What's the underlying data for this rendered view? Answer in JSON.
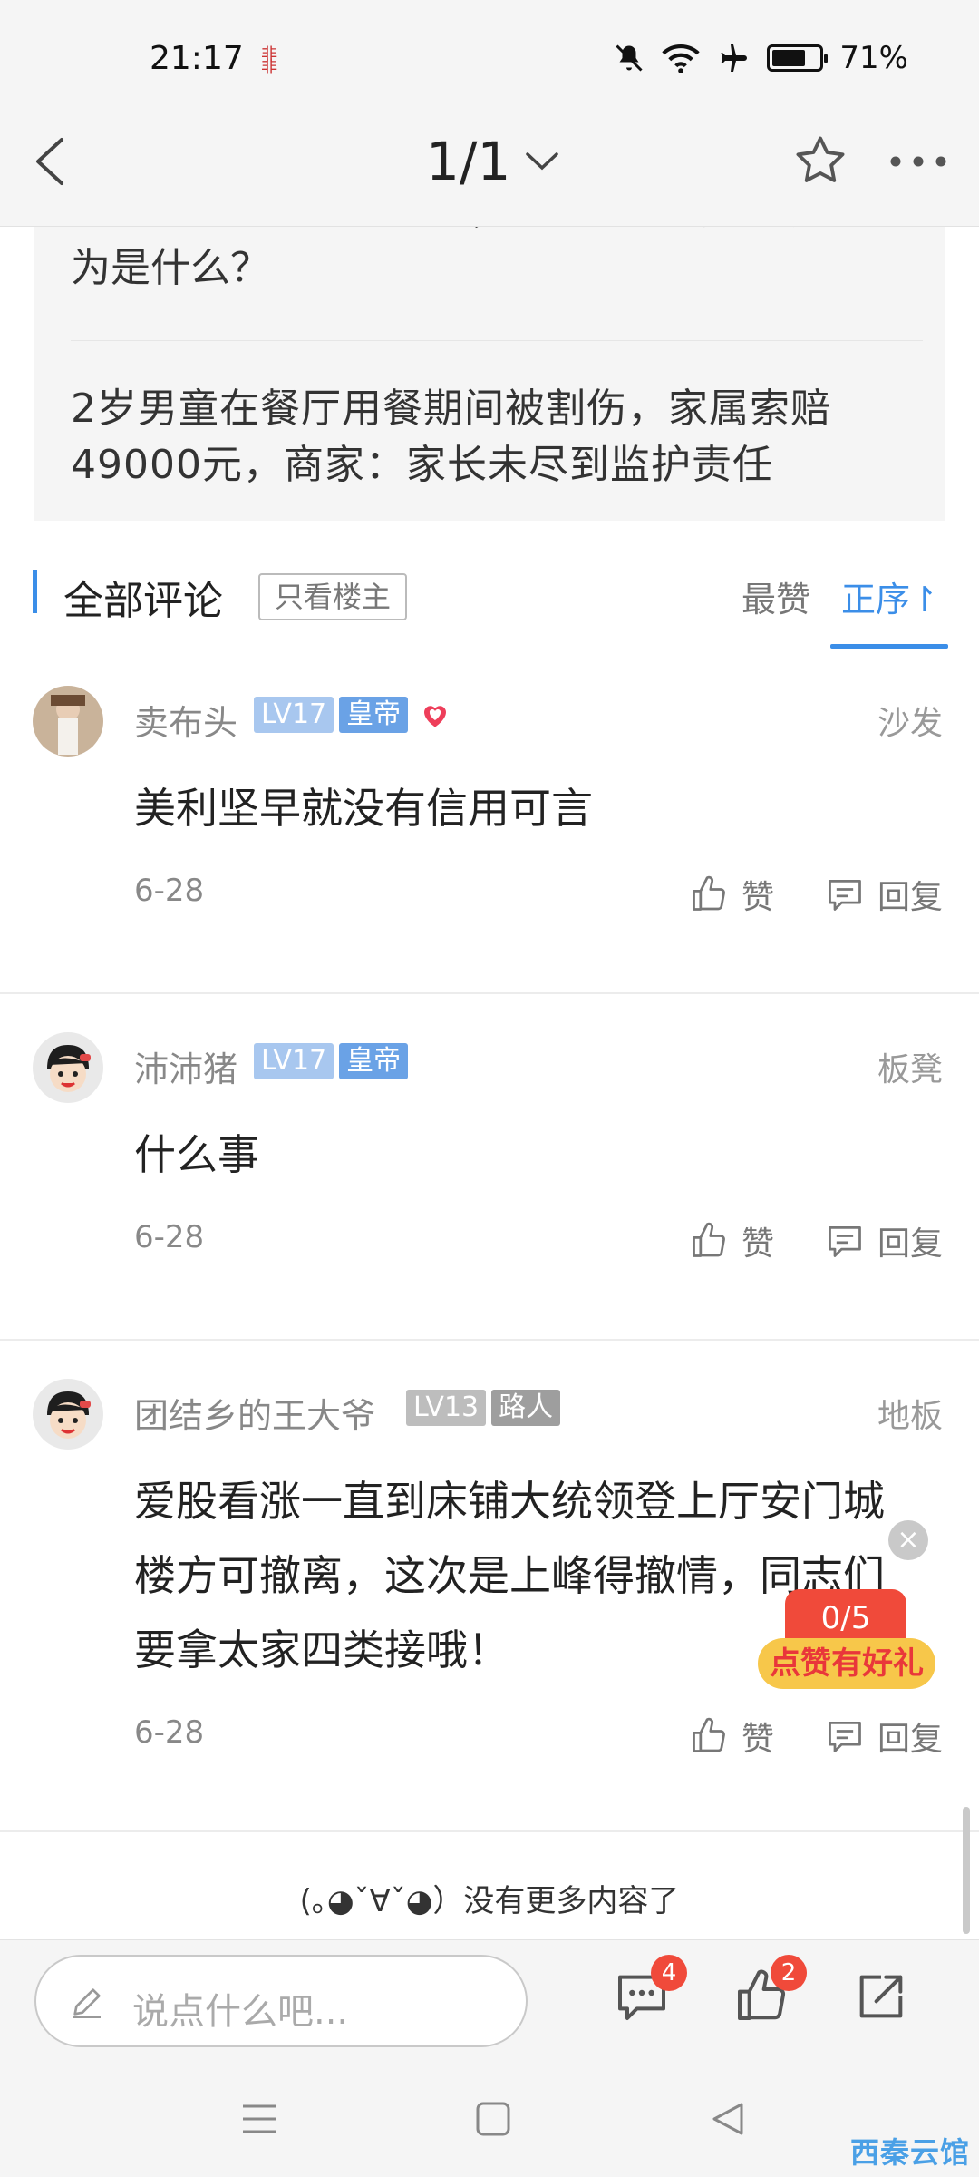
{
  "status_bar": {
    "time": "21:17",
    "battery": "71%",
    "battery_level": 0.71
  },
  "nav": {
    "title": "1/1"
  },
  "related": [
    {
      "title": "【晚八点红包】往百货，你最不能接受的开车行为是什么？"
    },
    {
      "title": "2岁男童在餐厅用餐期间被割伤，家属索赔49000元，商家：家长未尽到监护责任"
    }
  ],
  "comments_header": {
    "title": "全部评论",
    "op_only": "只看楼主",
    "sort_hot": "最赞",
    "sort_asc": "正序↾"
  },
  "comments": [
    {
      "username": "卖布头",
      "level": "LV17",
      "title": "皇帝",
      "floor": "沙发",
      "content": "美利坚早就没有信用可言",
      "date": "6-28",
      "like": "赞",
      "reply": "回复"
    },
    {
      "username": "沛沛猪",
      "level": "LV17",
      "title": "皇帝",
      "floor": "板凳",
      "content": "什么事",
      "date": "6-28",
      "like": "赞",
      "reply": "回复"
    },
    {
      "username": "团结乡的王大爷",
      "level": "LV13",
      "title": "路人",
      "floor": "地板",
      "content": "爱股看涨一直到床铺大统领登上厅安门城楼方可撤离，这次是上峰得撤情，同志们要拿太家四类接哦！",
      "date": "6-28",
      "like": "赞",
      "reply": "回复"
    }
  ],
  "popup": {
    "counter": "0/5",
    "label": "点赞有好礼"
  },
  "footer": {
    "no_more": "(｡◕ˇ∀ˇ◕）没有更多内容了"
  },
  "bottom_bar": {
    "placeholder": "说点什么吧...",
    "comment_count": "4",
    "like_count": "2"
  },
  "watermark": "西秦云馆",
  "colors": {
    "accent": "#3b8ee8",
    "badge_red": "#f04a3a"
  }
}
